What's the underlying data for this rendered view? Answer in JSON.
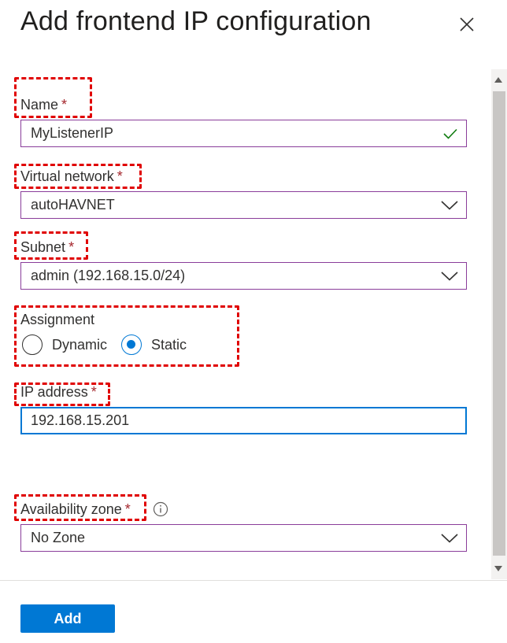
{
  "dialog": {
    "title": "Add frontend IP configuration",
    "close_icon": "close-icon"
  },
  "form": {
    "name": {
      "label": "Name",
      "required_mark": "*",
      "value": "MyListenerIP",
      "valid_icon": "checkmark-icon"
    },
    "virtual_network": {
      "label": "Virtual network",
      "required_mark": "*",
      "selected": "autoHAVNET"
    },
    "subnet": {
      "label": "Subnet",
      "required_mark": "*",
      "selected": "admin (192.168.15.0/24)"
    },
    "assignment": {
      "label": "Assignment",
      "options": [
        {
          "label": "Dynamic",
          "checked": false
        },
        {
          "label": "Static",
          "checked": true
        }
      ]
    },
    "ip_address": {
      "label": "IP address",
      "required_mark": "*",
      "value": "192.168.15.201"
    },
    "availability_zone": {
      "label": "Availability zone",
      "required_mark": "*",
      "info_icon": "info-icon",
      "selected": "No Zone"
    }
  },
  "footer": {
    "add_label": "Add"
  },
  "colors": {
    "accent": "#0078d4",
    "field_border": "#8a3d9a",
    "required": "#a4262c",
    "valid": "#107c10",
    "highlight_box": "#e00000"
  }
}
